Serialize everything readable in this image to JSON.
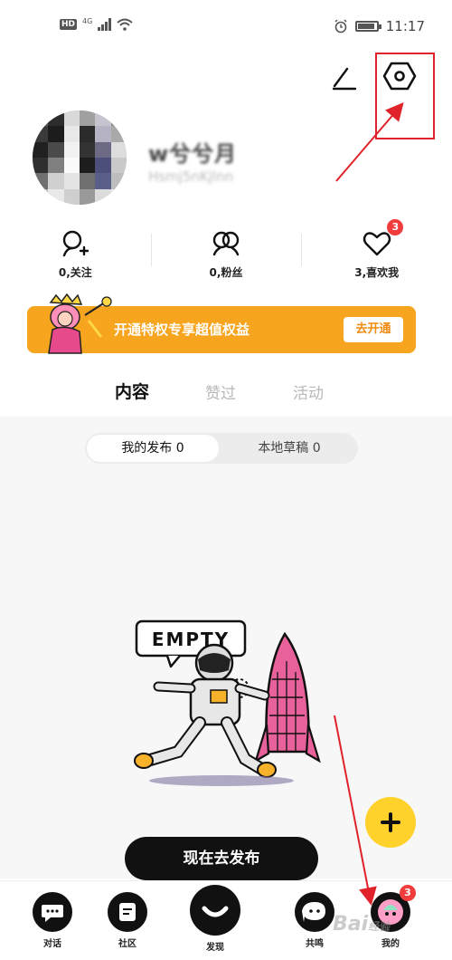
{
  "status_bar": {
    "left_badge": "HD",
    "network": "4G",
    "time": "11:17",
    "icons": [
      "hd-icon",
      "signal-icon",
      "wifi-icon",
      "alarm-icon",
      "battery-icon"
    ]
  },
  "top_actions": {
    "edit_icon": "edit-icon",
    "settings_icon": "settings-hexagon-icon"
  },
  "profile": {
    "username": "w兮兮月",
    "user_id": "Hsmj5nKjlnn"
  },
  "stats": [
    {
      "label": "0,关注",
      "icon": "follow-icon"
    },
    {
      "label": "0,粉丝",
      "icon": "fans-icon"
    },
    {
      "label": "3,喜欢我",
      "icon": "heart-icon",
      "badge": "3"
    }
  ],
  "vip_banner": {
    "text": "开通特权专享超值权益",
    "button": "去开通"
  },
  "tabs": [
    {
      "label": "内容",
      "active": true
    },
    {
      "label": "赞过",
      "active": false
    },
    {
      "label": "活动",
      "active": false
    }
  ],
  "segment": {
    "items": [
      {
        "label": "我的发布 0",
        "active": true
      },
      {
        "label": "本地草稿 0",
        "active": false
      }
    ]
  },
  "empty_state": {
    "sign_text": "EMPTY"
  },
  "publish_button": "现在去发布",
  "fab_icon": "plus-icon",
  "bottom_nav": [
    {
      "label": "对话",
      "icon": "chat-bubble-icon"
    },
    {
      "label": "社区",
      "icon": "community-icon"
    },
    {
      "label": "发现",
      "icon": "discover-smile-icon"
    },
    {
      "label": "共鸣",
      "icon": "resonance-icon"
    },
    {
      "label": "我的",
      "icon": "me-avatar-icon",
      "badge": "3"
    }
  ],
  "watermark": {
    "text": "Bai",
    "text2": "经验"
  },
  "colors": {
    "accent_orange": "#f7a51e",
    "fab_yellow": "#ffd12b",
    "annotation_red": "#e0232a",
    "badge_red": "#f03c3c"
  }
}
